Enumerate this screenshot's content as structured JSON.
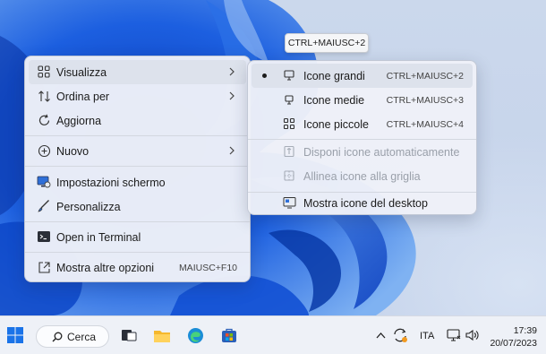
{
  "tooltip": "CTRL+MAIUSC+2",
  "context_menu": {
    "items": [
      {
        "label": "Visualizza",
        "icon": "grid-icon"
      },
      {
        "label": "Ordina per",
        "icon": "sort-icon"
      },
      {
        "label": "Aggiorna",
        "icon": "refresh-icon"
      },
      {
        "label": "Nuovo",
        "icon": "plus-circle-icon"
      },
      {
        "label": "Impostazioni schermo",
        "icon": "display-settings-icon"
      },
      {
        "label": "Personalizza",
        "icon": "brush-icon"
      },
      {
        "label": "Open in Terminal",
        "icon": "terminal-icon"
      },
      {
        "label": "Mostra altre opzioni",
        "icon": "share-icon",
        "shortcut": "MAIUSC+F10"
      }
    ]
  },
  "submenu": {
    "items": [
      {
        "label": "Icone grandi",
        "shortcut": "CTRL+MAIUSC+2",
        "selected": true,
        "icon": "monitor-icon"
      },
      {
        "label": "Icone medie",
        "shortcut": "CTRL+MAIUSC+3",
        "icon": "monitor-small-icon"
      },
      {
        "label": "Icone piccole",
        "shortcut": "CTRL+MAIUSC+4",
        "icon": "small-grid-icon"
      },
      {
        "label": "Disponi icone automaticamente",
        "disabled": true,
        "icon": "auto-arrange-icon"
      },
      {
        "label": "Allinea icone alla griglia",
        "disabled": true,
        "icon": "align-grid-icon"
      },
      {
        "label": "Mostra icone del desktop",
        "icon": "desktop-icons-icon"
      }
    ]
  },
  "taskbar": {
    "search_label": "Cerca",
    "language": "ITA",
    "time": "17:39",
    "date": "20/07/2023"
  },
  "colors": {
    "accent": "#0a5fd6",
    "menu_bg": "#eef1f8",
    "highlight": "#dde2ec"
  }
}
